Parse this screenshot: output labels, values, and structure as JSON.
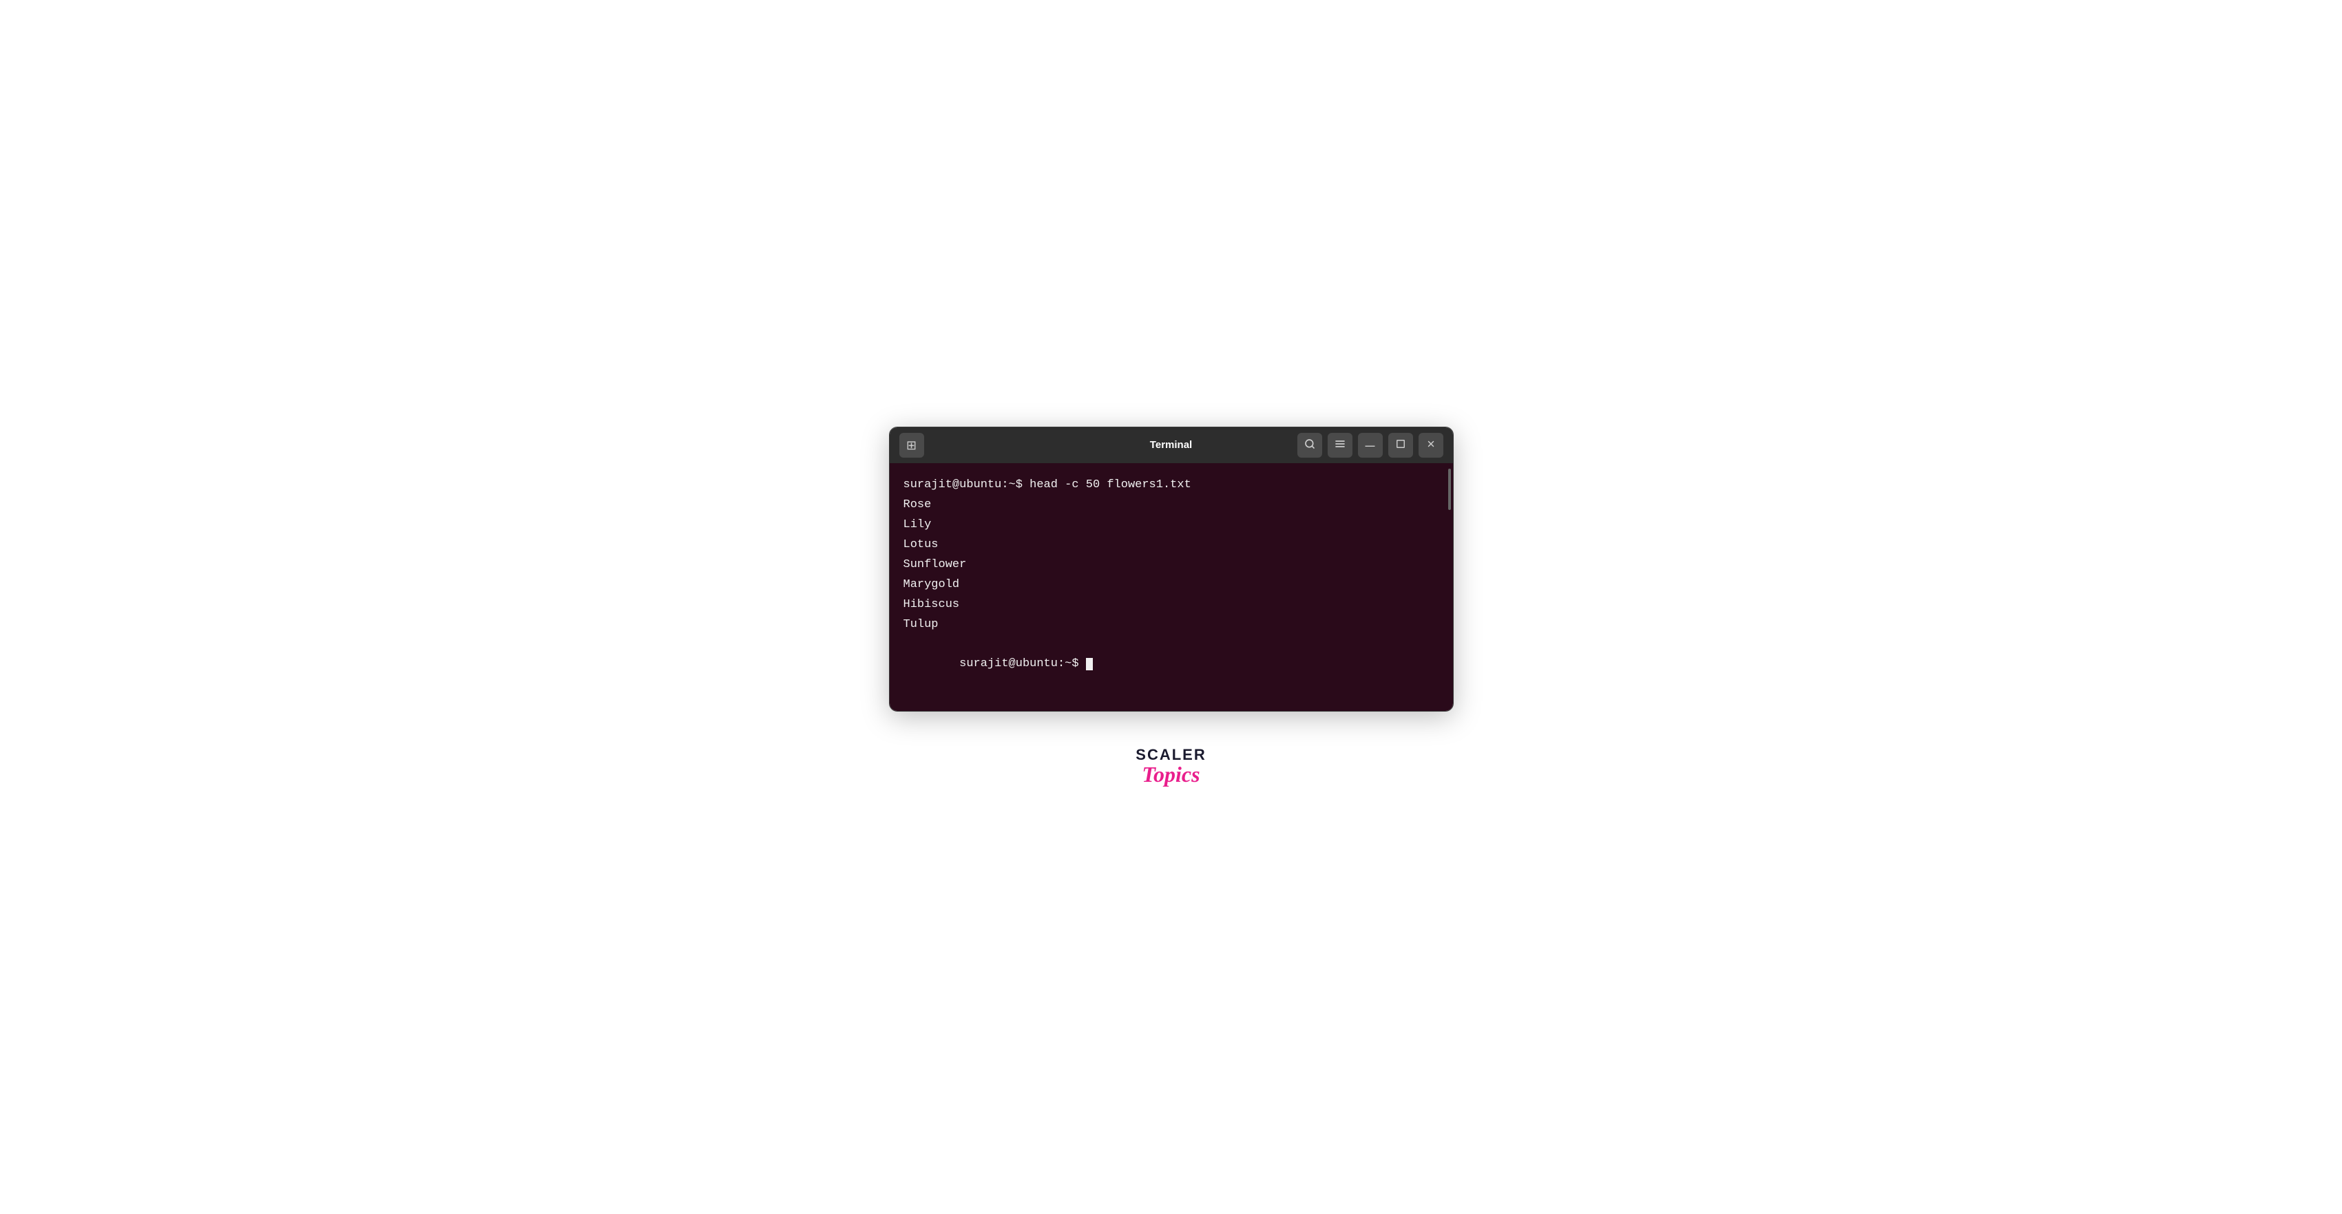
{
  "window": {
    "title": "Terminal",
    "new_tab_label": "⊞",
    "search_icon": "🔍",
    "menu_icon": "☰",
    "minimize_icon": "—",
    "maximize_icon": "□",
    "close_icon": "✕"
  },
  "terminal": {
    "background": "#2a0a1a",
    "command_line": "surajit@ubuntu:~$ head -c 50 flowers1.txt",
    "output_lines": [
      "Rose",
      "Lily",
      "Lotus",
      "Sunflower",
      "Marygold",
      "Hibiscus",
      "Tulup"
    ],
    "prompt_line": "surajit@ubuntu:~$ "
  },
  "branding": {
    "scaler_text": "SCALER",
    "topics_text": "Topics"
  }
}
